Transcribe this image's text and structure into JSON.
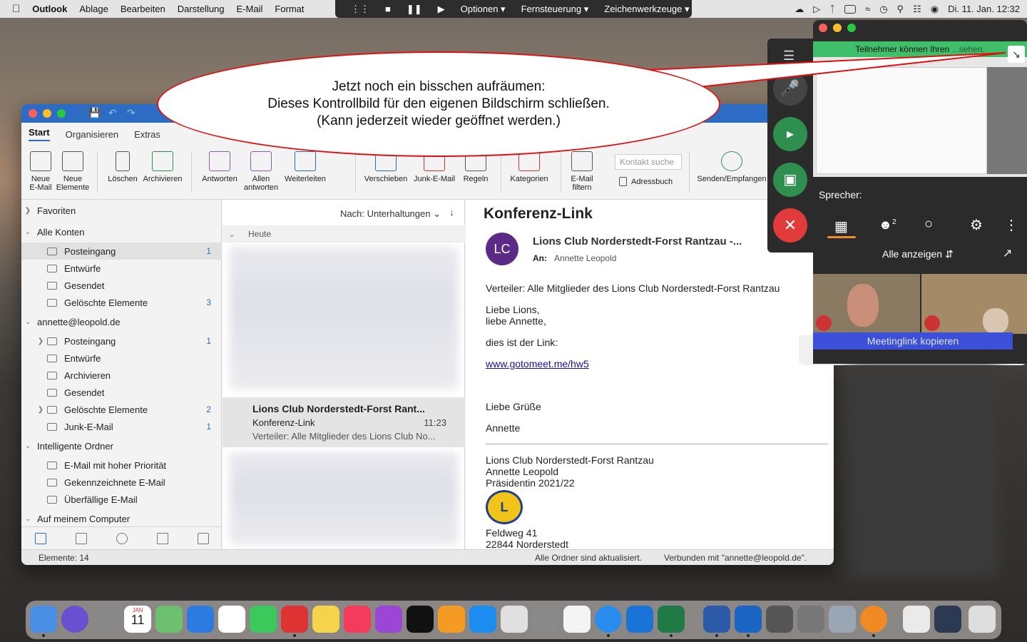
{
  "menubar": {
    "app": "Outlook",
    "items": [
      "Ablage",
      "Bearbeiten",
      "Darstellung",
      "E-Mail",
      "Format"
    ],
    "remote": {
      "options": "Optionen",
      "remote_control": "Fernsteuerung",
      "drawing_tools": "Zeichenwerkzeuge"
    },
    "clock": "Di. 11. Jan.  12:32"
  },
  "ribbon": {
    "tabs": [
      "Start",
      "Organisieren",
      "Extras"
    ],
    "buttons": {
      "new_mail": "Neue\nE-Mail",
      "new_items": "Neue\nElemente",
      "delete": "Löschen",
      "archive": "Archivieren",
      "reply": "Antworten",
      "reply_all": "Allen\nantworten",
      "forward": "Weiterleiten",
      "move": "Verschieben",
      "junk": "Junk-E-Mail",
      "rules": "Regeln",
      "categories": "Kategorien",
      "filter": "E-Mail\nfiltern",
      "address_book": "Adressbuch",
      "send_receive": "Senden/Empfangen"
    },
    "contact_search_placeholder": "Kontakt suche"
  },
  "sidebar": {
    "favorites": "Favoriten",
    "all_accounts": "Alle Konten",
    "all": [
      {
        "label": "Posteingang",
        "count": "1"
      },
      {
        "label": "Entwürfe",
        "count": ""
      },
      {
        "label": "Gesendet",
        "count": ""
      },
      {
        "label": "Gelöschte Elemente",
        "count": "3"
      }
    ],
    "account": "annette@leopold.de",
    "account_items": [
      {
        "label": "Posteingang",
        "count": "1"
      },
      {
        "label": "Entwürfe",
        "count": ""
      },
      {
        "label": "Archivieren",
        "count": ""
      },
      {
        "label": "Gesendet",
        "count": ""
      },
      {
        "label": "Gelöschte Elemente",
        "count": "2"
      },
      {
        "label": "Junk-E-Mail",
        "count": "1"
      }
    ],
    "smart_folders": "Intelligente Ordner",
    "smart_items": [
      "E-Mail mit hoher Priorität",
      "Gekennzeichnete E-Mail",
      "Überfällige E-Mail"
    ],
    "on_my_computer": "Auf meinem Computer"
  },
  "message_list": {
    "sort": "Nach: Unterhaltungen",
    "group_today": "Heute",
    "selected": {
      "sender": "Lions Club Norderstedt-Forst Rant...",
      "subject": "Konferenz-Link",
      "time": "11:23",
      "preview": "Verteiler: Alle Mitglieder des Lions Club No..."
    }
  },
  "reading": {
    "title": "Konferenz-Link",
    "avatar": "LC",
    "from": "Lions Club Norderstedt-Forst Rantzau -...",
    "to_label": "An:",
    "to": "Annette Leopold",
    "body": {
      "line1": "Verteiler: Alle Mitglieder des Lions Club Norderstedt-Forst Rantzau",
      "greet1": "Liebe Lions,",
      "greet2": "liebe Annette,",
      "text": "dies ist der Link:",
      "link": "www.gotomeet.me/hw5",
      "closing": "Liebe Grüße",
      "name": "Annette",
      "sig1": "Lions Club Norderstedt-Forst Rantzau",
      "sig2": "Annette Leopold",
      "sig3": "Präsidentin 2021/22",
      "addr1": "Feldweg 41",
      "addr2": "22844 Norderstedt"
    }
  },
  "status": {
    "items": "Elemente: 14",
    "updated": "Alle Ordner sind aktualisiert.",
    "connected": "Verbunden mit \"annette@leopold.de\"."
  },
  "meeting": {
    "banner": "Teilnehmer können Ihren",
    "banner2": "...sehen.",
    "speaker": "Sprecher:",
    "participants_count": "2",
    "view_all": "Alle anzeigen",
    "copy_link": "Meetinglink kopieren"
  },
  "bubble": {
    "line1": "Jetzt noch ein bisschen aufräumen:",
    "line2": "Dieses Kontrollbild für den eigenen Bildschirm schließen.",
    "line3": "(Kann jederzeit wieder geöffnet werden.)"
  },
  "dock": {
    "calendar_month": "JAN",
    "calendar_day": "11"
  },
  "colors": {
    "accent": "#2b6bc4",
    "avatar": "#5b2a86",
    "green": "#2f8f4e",
    "red": "#e23b3b",
    "bubble_border": "#e01010"
  }
}
